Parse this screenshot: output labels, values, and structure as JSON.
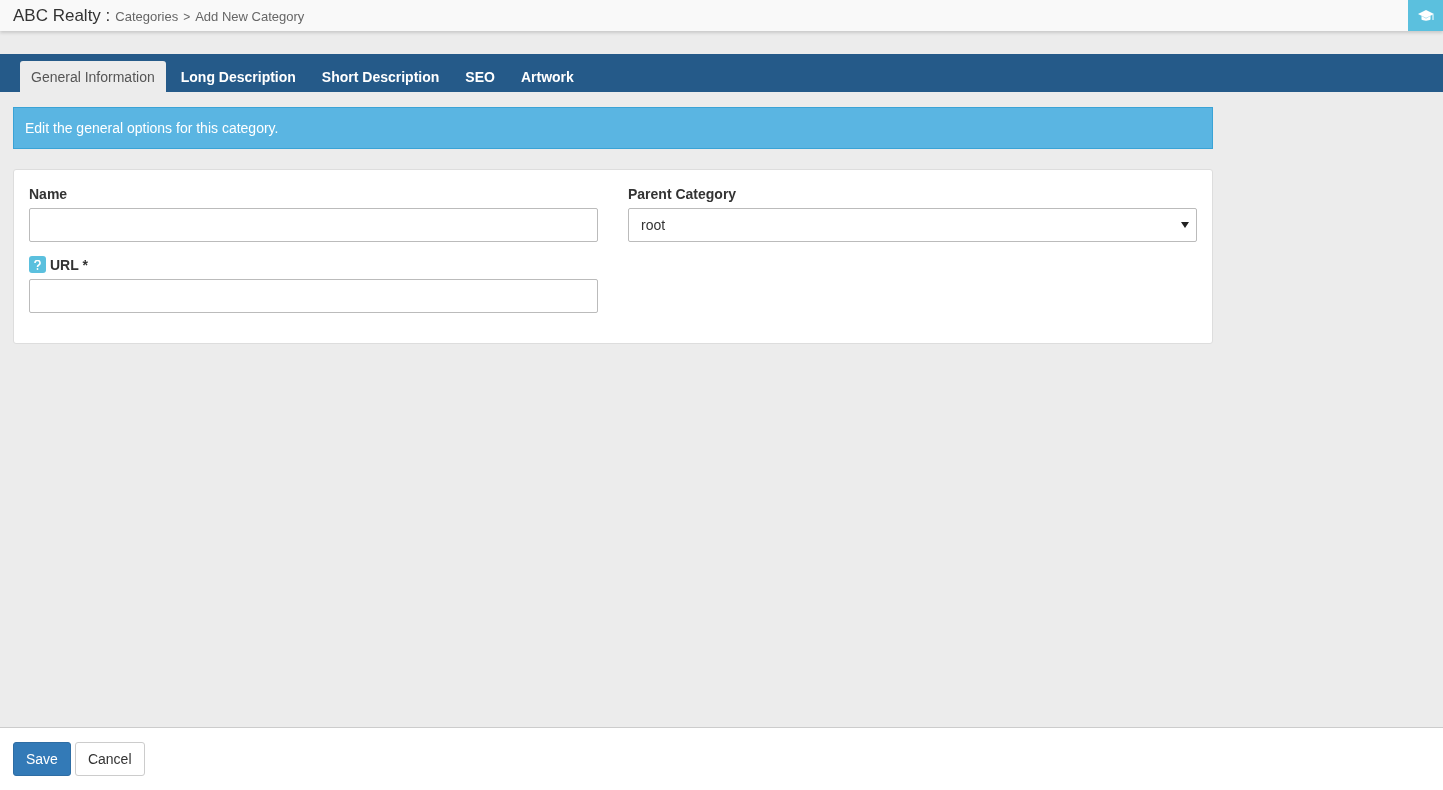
{
  "header": {
    "title": "ABC Realty :",
    "breadcrumbs": [
      "Categories",
      "Add New Category"
    ],
    "separator": ">"
  },
  "tabs": [
    {
      "label": "General Information",
      "selected": true
    },
    {
      "label": "Long Description",
      "selected": false
    },
    {
      "label": "Short Description",
      "selected": false
    },
    {
      "label": "SEO",
      "selected": false
    },
    {
      "label": "Artwork",
      "selected": false
    }
  ],
  "alert": "Edit the general options for this category.",
  "form": {
    "left": [
      {
        "label": "Name",
        "help": false
      },
      {
        "label": "URL *",
        "help": true
      }
    ],
    "right": [
      {
        "label": "Parent Category",
        "value": "root"
      }
    ]
  },
  "buttons": [
    {
      "label": "Save",
      "kind": "primary"
    },
    {
      "label": "Cancel",
      "kind": "default"
    }
  ]
}
